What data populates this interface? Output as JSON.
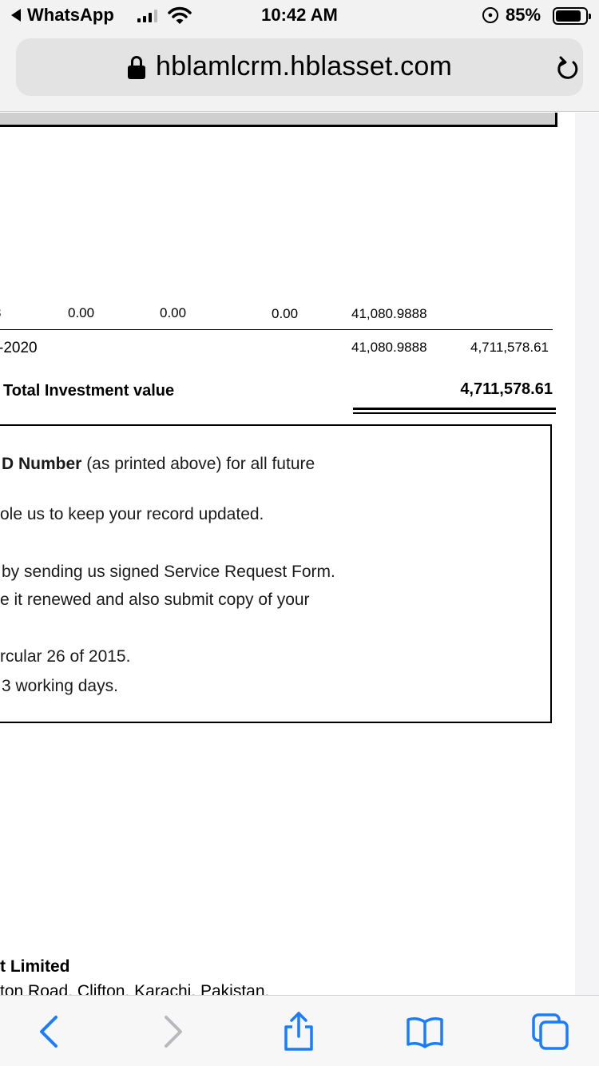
{
  "status_bar": {
    "back_app": "WhatsApp",
    "time": "10:42 AM",
    "battery": "85%",
    "battery_level": 0.85
  },
  "browser": {
    "url": "hblamlcrm.hblasset.com"
  },
  "statement": {
    "row1": {
      "lead": "3",
      "col1": "0.00",
      "col2": "0.00",
      "col3": "0.00",
      "units": "41,080.9888"
    },
    "row2": {
      "date_fragment": "-2020",
      "units": "41,080.9888",
      "value": "4,711,578.61"
    },
    "total_label": "Total Investment value",
    "total_value": "4,711,578.61"
  },
  "notice": {
    "line1_bold": "D Number",
    "line1_rest": " (as printed above) for all future",
    "line2": "ole us to keep your record updated.",
    "line3": "by sending us signed Service Request Form.",
    "line4": "e it renewed and also submit copy of your",
    "line5": "rcular 26 of 2015.",
    "line6": "3 working days."
  },
  "footer": {
    "company": "t Limited",
    "address": "ton Road, Clifton, Karachi, Pakistan."
  },
  "colors": {
    "accent": "#1a7cff",
    "disabled": "#b8b8bd"
  }
}
